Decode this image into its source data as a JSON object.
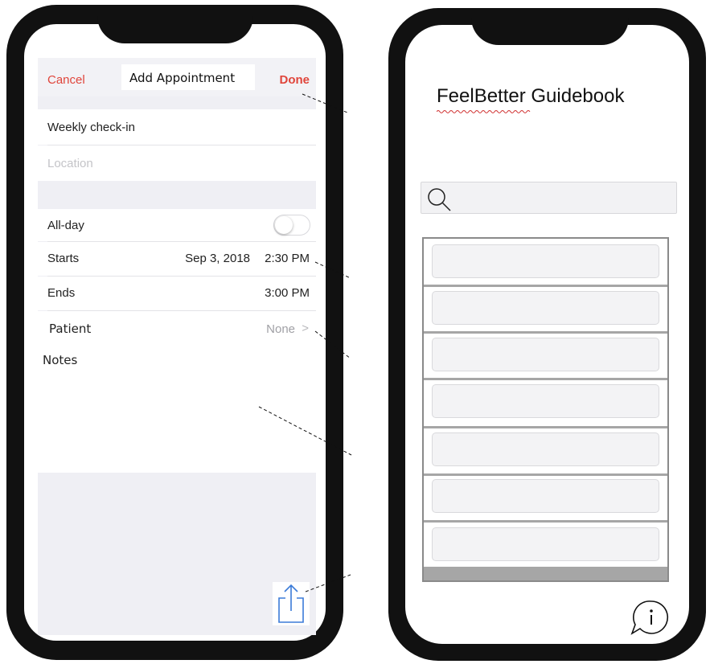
{
  "add_appointment": {
    "nav": {
      "cancel": "Cancel",
      "title": "Add Appointment",
      "done": "Done"
    },
    "title_field": "Weekly check-in",
    "location_placeholder": "Location",
    "all_day": {
      "label": "All-day",
      "on": false
    },
    "starts": {
      "label": "Starts",
      "date": "Sep 3, 2018",
      "time": "2:30 PM"
    },
    "ends": {
      "label": "Ends",
      "time": "3:00 PM"
    },
    "patient": {
      "label": "Patient",
      "value": "None",
      "chevron": ">"
    },
    "notes_label": "Notes",
    "share_icon": "share-icon",
    "accent_color": "#e0453b"
  },
  "guidebook": {
    "title": "FeelBetter Guidebook",
    "search_icon": "search-icon",
    "list_item_count_visible": 7,
    "info_icon": "info-icon"
  }
}
